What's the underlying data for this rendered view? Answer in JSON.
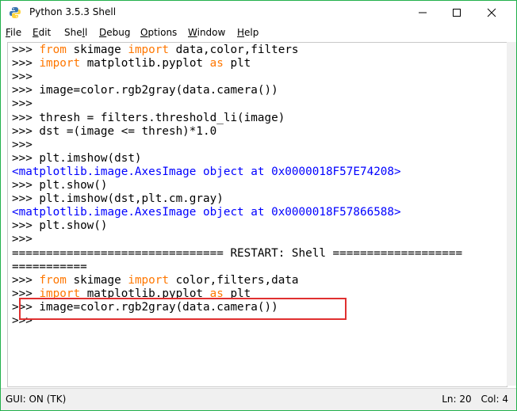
{
  "window": {
    "title": "Python 3.5.3 Shell",
    "border_color": "#22b14c"
  },
  "menu": {
    "items": [
      {
        "label_ul": "F",
        "label_rest": "ile"
      },
      {
        "label_ul": "E",
        "label_rest": "dit"
      },
      {
        "label_pre": "She",
        "label_ul": "l",
        "label_rest": "l"
      },
      {
        "label_ul": "D",
        "label_rest": "ebug"
      },
      {
        "label_ul": "O",
        "label_rest": "ptions"
      },
      {
        "label_ul": "W",
        "label_rest": "indow"
      },
      {
        "label_ul": "H",
        "label_rest": "elp"
      }
    ]
  },
  "shell": {
    "prompt": ">>> ",
    "colors": {
      "keyword": "#ff7700",
      "output": "#0000ff",
      "text": "#000000"
    },
    "lines": [
      {
        "parts": [
          {
            "t": ">>> ",
            "c": ""
          },
          {
            "t": "from",
            "c": "kw"
          },
          {
            "t": " skimage ",
            "c": ""
          },
          {
            "t": "import",
            "c": "kw"
          },
          {
            "t": " data,color,filters",
            "c": ""
          }
        ]
      },
      {
        "parts": [
          {
            "t": ">>> ",
            "c": ""
          },
          {
            "t": "import",
            "c": "kw"
          },
          {
            "t": " matplotlib.pyplot ",
            "c": ""
          },
          {
            "t": "as",
            "c": "kw"
          },
          {
            "t": " plt",
            "c": ""
          }
        ]
      },
      {
        "parts": [
          {
            "t": ">>>",
            "c": ""
          }
        ]
      },
      {
        "parts": [
          {
            "t": ">>> image=color.rgb2gray(data.camera())",
            "c": ""
          }
        ]
      },
      {
        "parts": [
          {
            "t": ">>>",
            "c": ""
          }
        ]
      },
      {
        "parts": [
          {
            "t": ">>> thresh = filters.threshold_li(image)",
            "c": ""
          }
        ]
      },
      {
        "parts": [
          {
            "t": ">>> dst =(image <= thresh)*1.0",
            "c": ""
          }
        ]
      },
      {
        "parts": [
          {
            "t": ">>>",
            "c": ""
          }
        ]
      },
      {
        "parts": [
          {
            "t": ">>> plt.imshow(dst)",
            "c": ""
          }
        ]
      },
      {
        "parts": [
          {
            "t": "<matplotlib.image.AxesImage object at 0x0000018F57E74208>",
            "c": "out"
          }
        ]
      },
      {
        "parts": [
          {
            "t": ">>> plt.show()",
            "c": ""
          }
        ]
      },
      {
        "parts": [
          {
            "t": ">>> plt.imshow(dst,plt.cm.gray)",
            "c": ""
          }
        ]
      },
      {
        "parts": [
          {
            "t": "<matplotlib.image.AxesImage object at 0x0000018F57866588>",
            "c": "out"
          }
        ]
      },
      {
        "parts": [
          {
            "t": ">>> plt.show()",
            "c": ""
          }
        ]
      },
      {
        "parts": [
          {
            "t": ">>>",
            "c": ""
          }
        ]
      },
      {
        "parts": [
          {
            "t": "=============================== RESTART: Shell ===================",
            "c": ""
          }
        ]
      },
      {
        "parts": [
          {
            "t": "===========",
            "c": ""
          }
        ]
      },
      {
        "parts": [
          {
            "t": ">>> ",
            "c": ""
          },
          {
            "t": "from",
            "c": "kw"
          },
          {
            "t": " skimage ",
            "c": ""
          },
          {
            "t": "import",
            "c": "kw"
          },
          {
            "t": " color,filters,data",
            "c": ""
          }
        ]
      },
      {
        "parts": [
          {
            "t": ">>> ",
            "c": ""
          },
          {
            "t": "import",
            "c": "kw"
          },
          {
            "t": " matplotlib.pyplot ",
            "c": ""
          },
          {
            "t": "as",
            "c": "kw"
          },
          {
            "t": " plt",
            "c": ""
          }
        ]
      },
      {
        "parts": [
          {
            "t": ">>> image=color.rgb2gray(data.camera())",
            "c": ""
          }
        ]
      },
      {
        "parts": [
          {
            "t": ">>>",
            "c": ""
          }
        ]
      }
    ]
  },
  "status": {
    "left": "GUI: ON (TK)",
    "line": "Ln: 20",
    "col": "Col: 4"
  },
  "icons": {
    "app": "python-icon",
    "minimize": "minimize-icon",
    "maximize": "maximize-icon",
    "close": "close-icon"
  }
}
